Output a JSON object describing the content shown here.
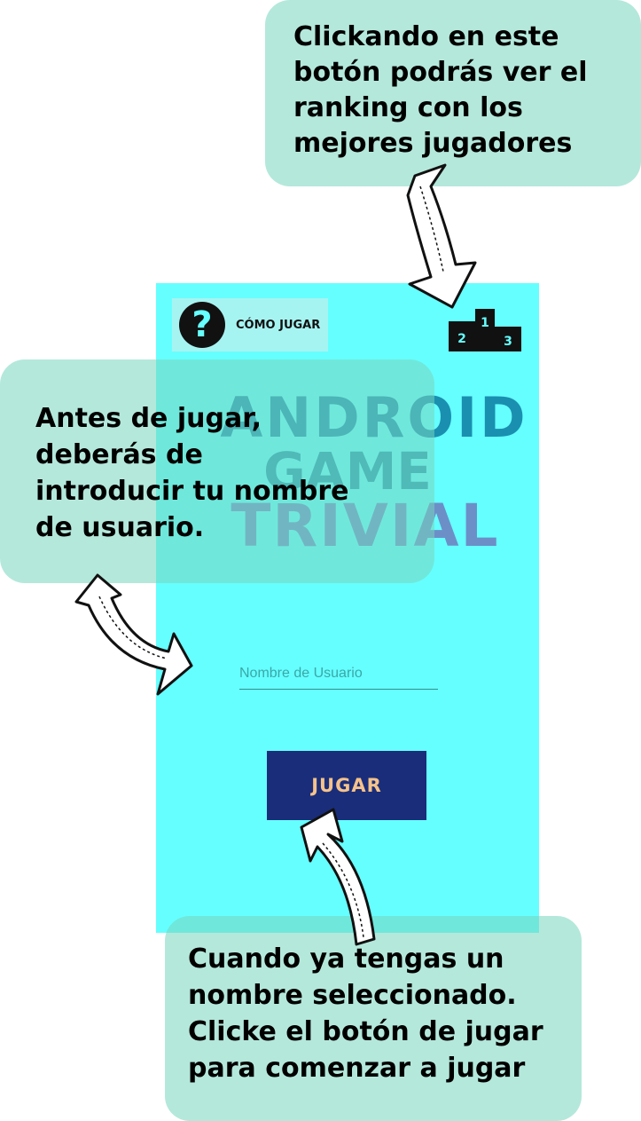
{
  "app": {
    "how_to_play_label": "CÓMO JUGAR",
    "how_to_play_icon": "question-icon",
    "ranking_icon": "podium-icon",
    "ranking_places": [
      "2",
      "1",
      "3"
    ],
    "logo_lines": [
      "ANDROID",
      "GAME",
      "TRIVIAL"
    ],
    "username_placeholder": "Nombre de Usuario",
    "username_value": "",
    "play_label": "JUGAR"
  },
  "tutorial": {
    "ranking_tip": [
      "Clickando en este",
      "botón podrás ver el",
      "ranking con los",
      "mejores jugadores"
    ],
    "username_tip": [
      "Antes de jugar,",
      "deberás de",
      "introducir tu nombre",
      "de usuario."
    ],
    "play_tip": [
      "Cuando ya tengas un",
      "nombre seleccionado.",
      "Clicke el botón de jugar",
      "para comenzar a jugar"
    ]
  },
  "colors": {
    "screen_bg": "#66ffff",
    "play_button_bg": "#1a2d7a",
    "play_button_text": "#f5c38b",
    "bubble_bg": "#76d6be"
  }
}
